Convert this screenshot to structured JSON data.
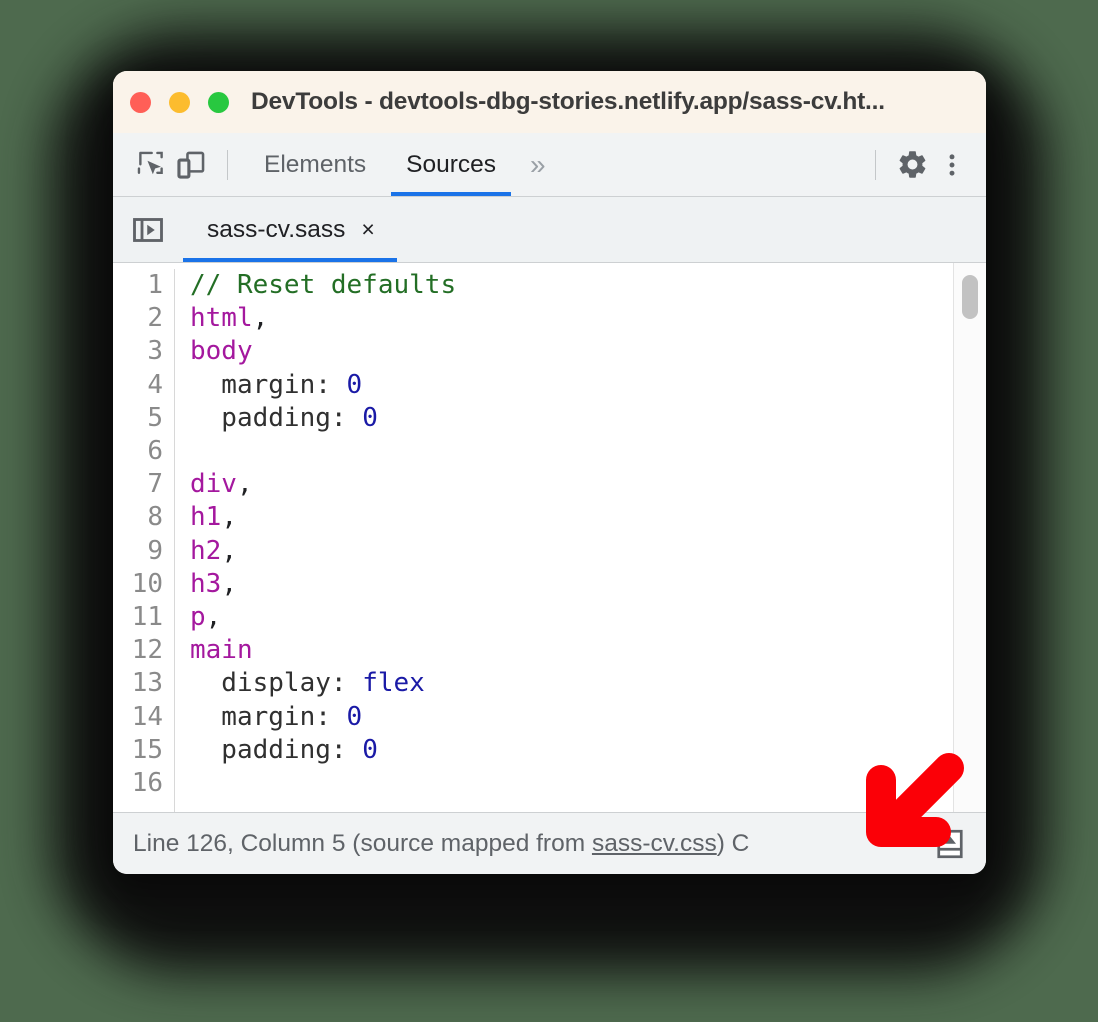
{
  "window": {
    "title": "DevTools - devtools-dbg-stories.netlify.app/sass-cv.ht...",
    "traffic_lights": [
      "close",
      "minimize",
      "zoom"
    ]
  },
  "colors": {
    "background": "#4e6a4e",
    "titlebar": "#faf3ea",
    "toolbar": "#f1f3f4",
    "accent_blue": "#1a73e8",
    "comment_green": "#236e25",
    "selector_magenta": "#a4189e",
    "value_blue": "#1a1aa6",
    "annotation_red": "#fb0007",
    "light_red": "#ff5f57",
    "light_yellow": "#fcbc2e",
    "light_green": "#28c840"
  },
  "toolbar": {
    "inspect_icon": "inspect-element-icon",
    "device_icon": "device-toolbar-icon",
    "tabs": [
      {
        "label": "Elements",
        "active": false
      },
      {
        "label": "Sources",
        "active": true
      }
    ],
    "overflow_label": "»",
    "settings_icon": "gear-icon",
    "more_icon": "kebab-menu-icon"
  },
  "tabstrip": {
    "navigator_toggle_icon": "show-navigator-icon",
    "files": [
      {
        "name": "sass-cv.sass",
        "active": true,
        "close_label": "×"
      }
    ]
  },
  "editor": {
    "line_numbers": [
      "1",
      "2",
      "3",
      "4",
      "5",
      "6",
      "7",
      "8",
      "9",
      "10",
      "11",
      "12",
      "13",
      "14",
      "15",
      "16"
    ],
    "lines": [
      {
        "num": "1",
        "tokens": [
          {
            "t": "// Reset defaults",
            "c": "tok-comment"
          }
        ]
      },
      {
        "num": "2",
        "tokens": [
          {
            "t": "html",
            "c": "tok-sel"
          },
          {
            "t": ",",
            "c": "tok-punc"
          }
        ]
      },
      {
        "num": "3",
        "tokens": [
          {
            "t": "body",
            "c": "tok-sel"
          }
        ]
      },
      {
        "num": "4",
        "tokens": [
          {
            "t": "  margin: ",
            "c": "tok-prop"
          },
          {
            "t": "0",
            "c": "tok-num"
          }
        ]
      },
      {
        "num": "5",
        "tokens": [
          {
            "t": "  padding: ",
            "c": "tok-prop"
          },
          {
            "t": "0",
            "c": "tok-num"
          }
        ]
      },
      {
        "num": "6",
        "tokens": [
          {
            "t": "",
            "c": "tok-punc"
          }
        ]
      },
      {
        "num": "7",
        "tokens": [
          {
            "t": "div",
            "c": "tok-sel"
          },
          {
            "t": ",",
            "c": "tok-punc"
          }
        ]
      },
      {
        "num": "8",
        "tokens": [
          {
            "t": "h1",
            "c": "tok-sel"
          },
          {
            "t": ",",
            "c": "tok-punc"
          }
        ]
      },
      {
        "num": "9",
        "tokens": [
          {
            "t": "h2",
            "c": "tok-sel"
          },
          {
            "t": ",",
            "c": "tok-punc"
          }
        ]
      },
      {
        "num": "10",
        "tokens": [
          {
            "t": "h3",
            "c": "tok-sel"
          },
          {
            "t": ",",
            "c": "tok-punc"
          }
        ]
      },
      {
        "num": "11",
        "tokens": [
          {
            "t": "p",
            "c": "tok-sel"
          },
          {
            "t": ",",
            "c": "tok-punc"
          }
        ]
      },
      {
        "num": "12",
        "tokens": [
          {
            "t": "main",
            "c": "tok-sel"
          }
        ]
      },
      {
        "num": "13",
        "tokens": [
          {
            "t": "  display: ",
            "c": "tok-prop"
          },
          {
            "t": "flex",
            "c": "tok-val"
          }
        ]
      },
      {
        "num": "14",
        "tokens": [
          {
            "t": "  margin: ",
            "c": "tok-prop"
          },
          {
            "t": "0",
            "c": "tok-num"
          }
        ]
      },
      {
        "num": "15",
        "tokens": [
          {
            "t": "  padding: ",
            "c": "tok-prop"
          },
          {
            "t": "0",
            "c": "tok-num"
          }
        ]
      },
      {
        "num": "16",
        "tokens": [
          {
            "t": "",
            "c": "tok-punc"
          }
        ]
      }
    ],
    "scrollbar": {
      "name": "vertical-scrollbar"
    }
  },
  "statusbar": {
    "prefix": "Line 126, Column 5  (source mapped from ",
    "source_link": "sass-cv.css",
    "suffix": ") C",
    "pretty_print_icon": "pretty-print-icon"
  },
  "annotation": {
    "arrow": "red-arrow-pointing-down-left"
  }
}
